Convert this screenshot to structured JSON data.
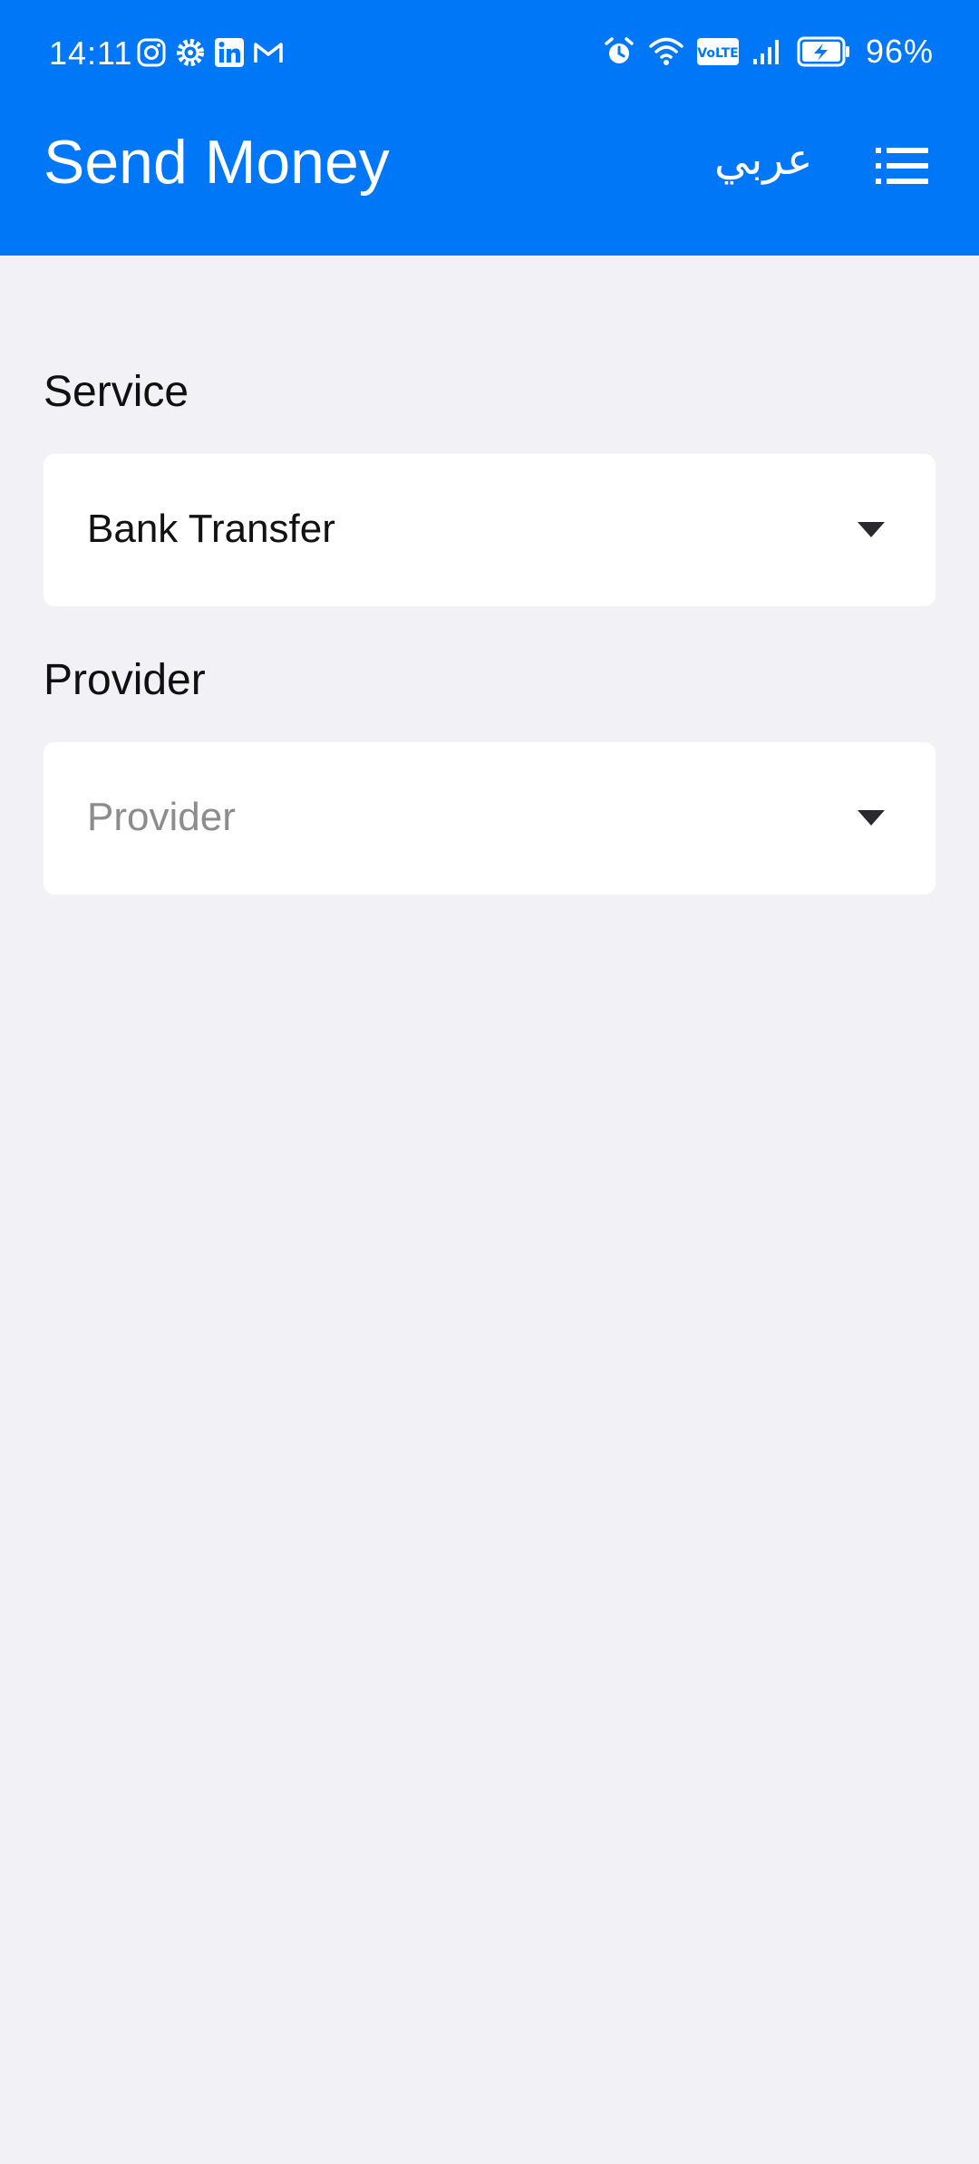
{
  "status_bar": {
    "time": "14:11",
    "battery_percent": "96%",
    "volte_label": "VoLTE",
    "app_icons": [
      "instagram-icon",
      "settings-gear-icon",
      "linkedin-icon",
      "gmail-icon"
    ],
    "system_icons": [
      "alarm-icon",
      "wifi-icon",
      "volte-icon",
      "signal-icon",
      "battery-charging-icon"
    ]
  },
  "header": {
    "title": "Send Money",
    "language_toggle": "عربي",
    "menu_icon": "list-menu-icon",
    "background_color": "#0077f6"
  },
  "form": {
    "service": {
      "label": "Service",
      "selected_value": "Bank Transfer"
    },
    "provider": {
      "label": "Provider",
      "placeholder": "Provider"
    },
    "dropdown_icon": "caret-down-icon"
  },
  "colors": {
    "accent": "#0077f6",
    "page_background": "#f1f1f6",
    "field_background": "#ffffff",
    "placeholder_text": "#8c8c8c"
  }
}
